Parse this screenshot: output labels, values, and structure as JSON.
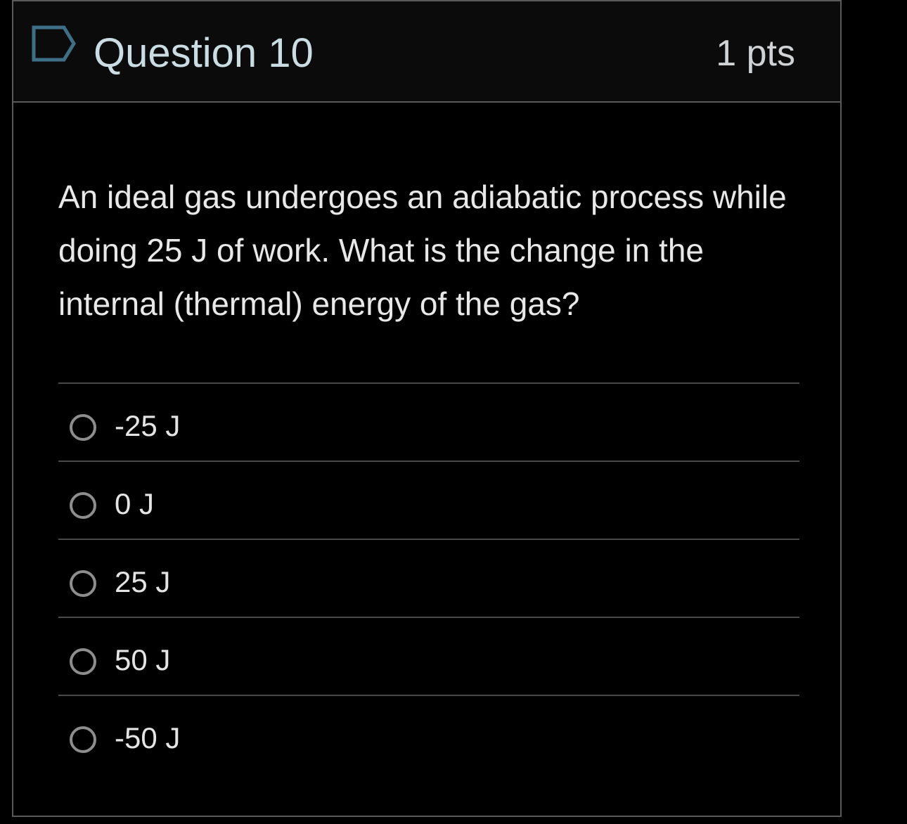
{
  "question": {
    "title": "Question 10",
    "points": "1 pts",
    "flag_icon": "flag-bookmark-icon",
    "text": "An ideal gas undergoes an adiabatic process while doing 25 J of work. What is the change in the internal (thermal) energy of the gas?"
  },
  "answers": [
    {
      "label": "-25 J"
    },
    {
      "label": "0 J"
    },
    {
      "label": "25 J"
    },
    {
      "label": "50 J"
    },
    {
      "label": "-50 J"
    }
  ],
  "colors": {
    "background": "#000000",
    "header_background": "#0b0b0b",
    "border": "#5a5a5a",
    "flag_outline": "#3d6f86",
    "radio_border": "#8d8d8d"
  }
}
